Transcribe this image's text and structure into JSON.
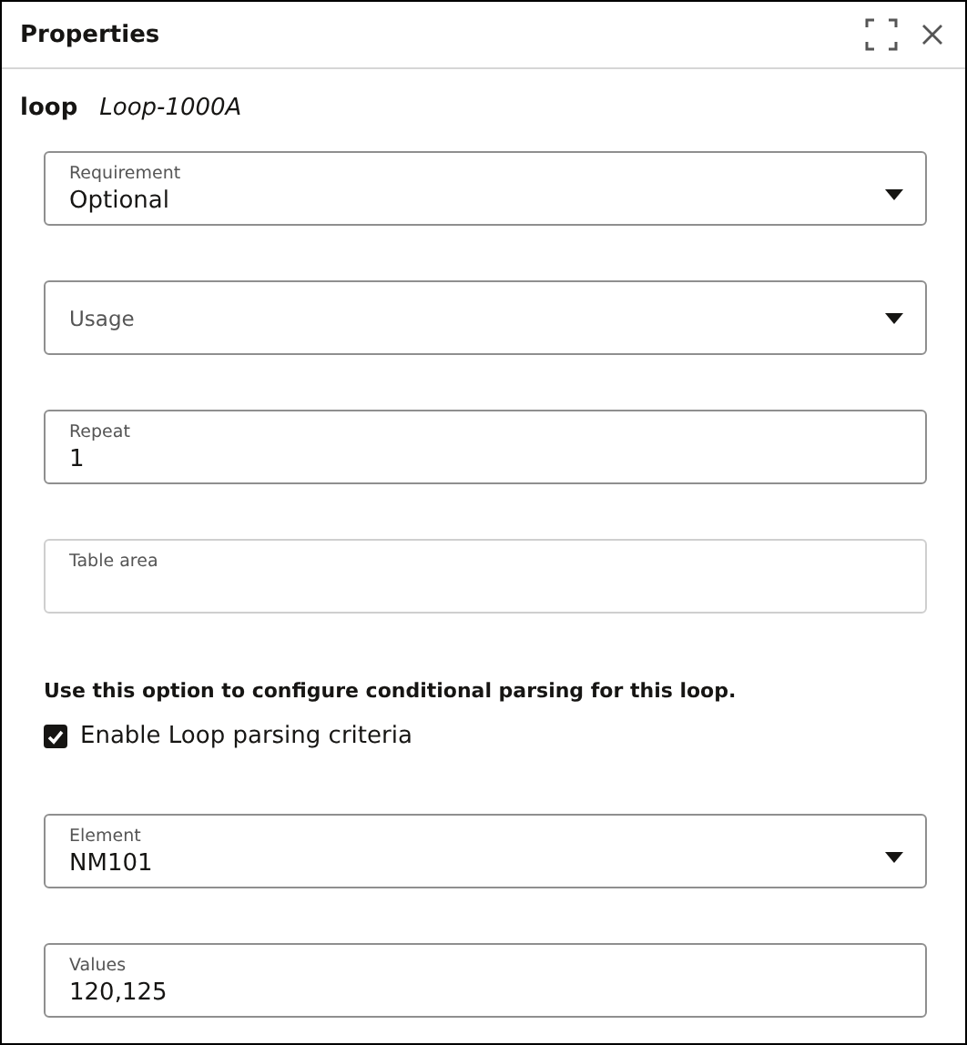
{
  "panel": {
    "title": "Properties"
  },
  "heading": {
    "type": "loop",
    "name": "Loop-1000A"
  },
  "fields": [
    {
      "kind": "select",
      "label": "Requirement",
      "value": "Optional"
    },
    {
      "kind": "select",
      "label": "Usage"
    },
    {
      "kind": "text",
      "label": "Repeat",
      "value": "1"
    },
    {
      "kind": "textarea",
      "label": "Table area"
    }
  ],
  "hint": "Use this option to configure conditional parsing for this loop.",
  "checkbox": {
    "label": "Enable Loop parsing criteria",
    "checked": true
  },
  "criteria_fields": [
    {
      "kind": "select",
      "label": "Element",
      "value": "NM101"
    },
    {
      "kind": "text",
      "label": "Values",
      "value": "120,125"
    }
  ]
}
